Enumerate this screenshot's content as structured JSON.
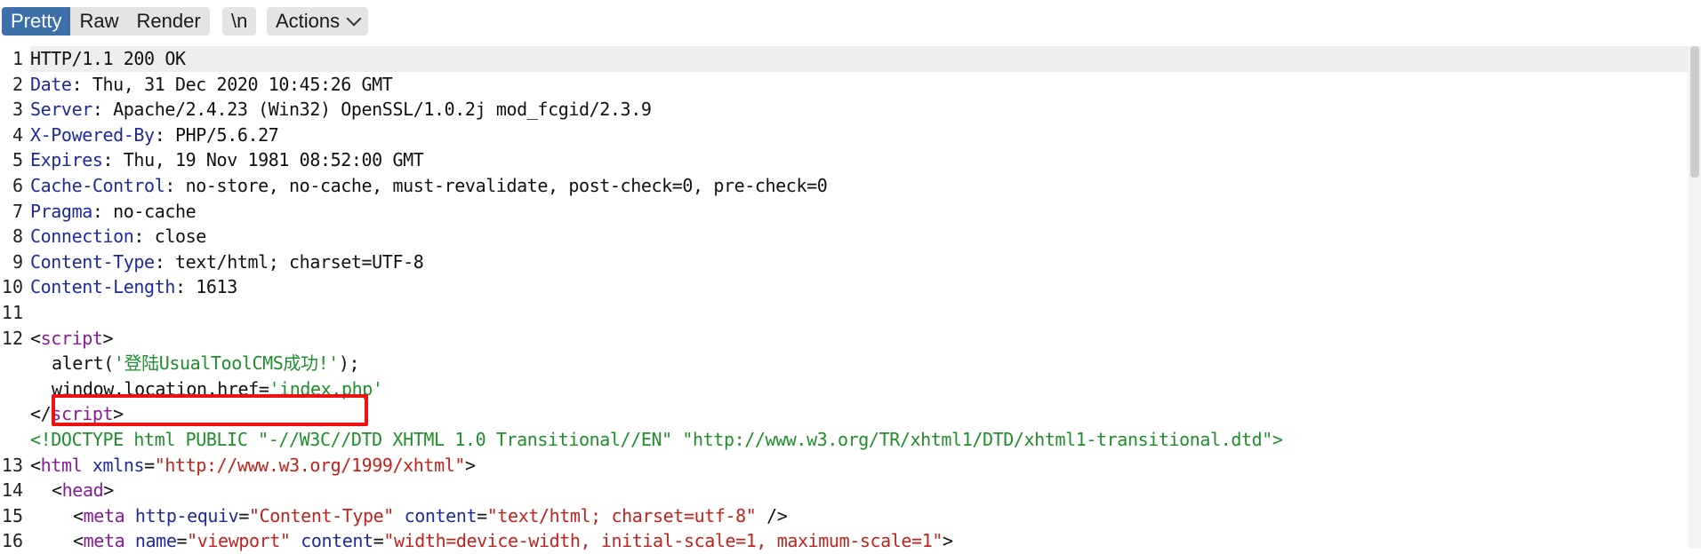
{
  "toolbar": {
    "pretty": "Pretty",
    "raw": "Raw",
    "render": "Render",
    "newline": "\\n",
    "actions": "Actions"
  },
  "lines": [
    {
      "num": "1"
    },
    {
      "num": "2",
      "key": "Date",
      "value": ": Thu, 31 Dec 2020 10:45:26 GMT"
    },
    {
      "num": "3",
      "key": "Server",
      "value": ": Apache/2.4.23 (Win32) OpenSSL/1.0.2j mod_fcgid/2.3.9"
    },
    {
      "num": "4",
      "key": "X-Powered-By",
      "value": ": PHP/5.6.27"
    },
    {
      "num": "5",
      "key": "Expires",
      "value": ": Thu, 19 Nov 1981 08:52:00 GMT"
    },
    {
      "num": "6",
      "key": "Cache-Control",
      "value": ": no-store, no-cache, must-revalidate, post-check=0, pre-check=0"
    },
    {
      "num": "7",
      "key": "Pragma",
      "value": ": no-cache"
    },
    {
      "num": "8",
      "key": "Connection",
      "value": ": close"
    },
    {
      "num": "9",
      "key": "Content-Type",
      "value": ": text/html; charset=UTF-8"
    },
    {
      "num": "10",
      "key": "Content-Length",
      "value": ": 1613"
    },
    {
      "num": "11"
    },
    {
      "num": "12"
    },
    {
      "num": "13"
    },
    {
      "num": "14"
    },
    {
      "num": "15"
    },
    {
      "num": "16"
    }
  ],
  "status_line": "HTTP/1.1 200 OK",
  "code": {
    "script_open_lt": "<",
    "script_tag": "script",
    "script_open_gt": ">",
    "alert_fn": "alert(",
    "alert_str": "'登陆UsualToolCMS成功!'",
    "alert_close": ");",
    "window_loc": "window.location.href=",
    "window_str": "'index.php'",
    "script_close_lt": "</",
    "script_close_gt": ">",
    "doctype": "<!DOCTYPE html PUBLIC \"-//W3C//DTD XHTML 1.0 Transitional//EN\" \"http://www.w3.org/TR/xhtml1/DTD/xhtml1-transitional.dtd\">",
    "html_tag": "html",
    "xmlns_attr": "xmlns",
    "xmlns_val": "\"http://www.w3.org/1999/xhtml\"",
    "head_tag": "head",
    "meta_tag": "meta",
    "http_equiv_attr": "http-equiv",
    "http_equiv_val": "\"Content-Type\"",
    "content_attr": "content",
    "content_val": "\"text/html; charset=utf-8\"",
    "selfclose": " />",
    "name_attr": "name",
    "name_val": "\"viewport\"",
    "viewport_val": "\"width=device-width, initial-scale=1, maximum-scale=1\"",
    "eq": "=",
    "lt": "<",
    "gt": ">"
  }
}
